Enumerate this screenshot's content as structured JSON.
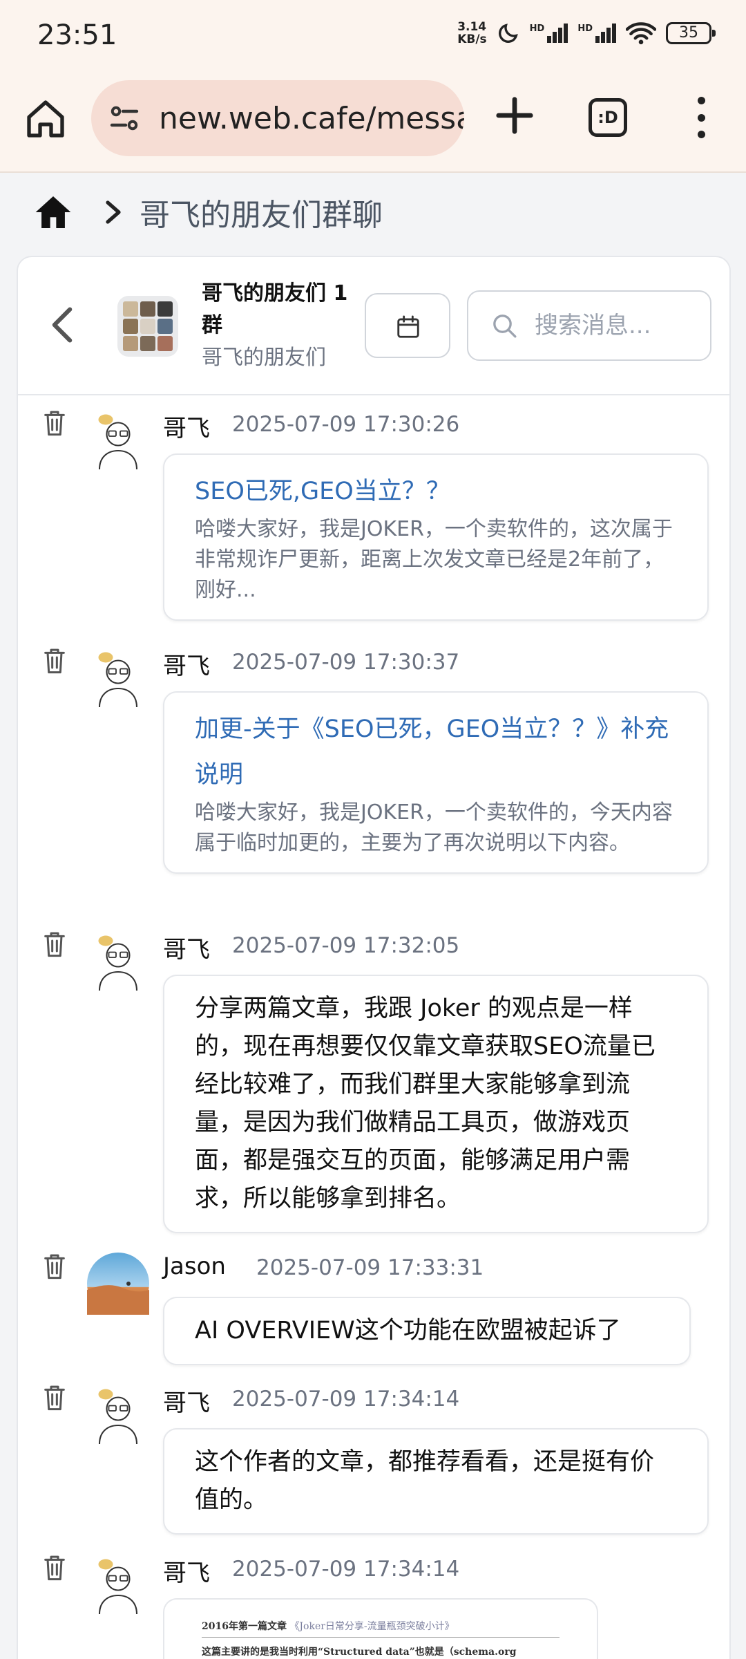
{
  "status_bar": {
    "time": "23:51",
    "net_speed_value": "3.14",
    "net_speed_unit": "KB/s",
    "sig1_label": "HD",
    "sig2_label": "HD",
    "battery": "35",
    "icons": [
      "moon-icon",
      "signal-icon",
      "signal-icon",
      "wifi-icon",
      "battery-icon"
    ]
  },
  "browser": {
    "url": "new.web.cafe/messag",
    "tabs_label": ":D",
    "icons": [
      "home-icon",
      "site-settings-icon",
      "plus-icon",
      "tabs-icon",
      "more-icon"
    ]
  },
  "breadcrumb": {
    "title": "哥飞的朋友们群聊"
  },
  "chat_header": {
    "group_name": "哥飞的朋友们 1 群",
    "group_sub": "哥飞的朋友们",
    "search_placeholder": "搜索消息..."
  },
  "messages": [
    {
      "sender": "哥飞",
      "time": "2025-07-09 17:30:26",
      "type": "link",
      "link_title": "SEO已死,GEO当立？？",
      "link_desc": "哈喽大家好，我是JOKER，一个卖软件的，这次属于非常规诈尸更新，距离上次发文章已经是2年前了，刚好..."
    },
    {
      "sender": "哥飞",
      "time": "2025-07-09 17:30:37",
      "type": "link",
      "link_title": "加更-关于《SEO已死，GEO当立？？》补充说明",
      "link_desc": "哈喽大家好，我是JOKER，一个卖软件的，今天内容属于临时加更的，主要为了再次说明以下内容。"
    },
    {
      "sender": "哥飞",
      "time": "2025-07-09 17:32:05",
      "type": "text",
      "text": "分享两篇文章，我跟 Joker 的观点是一样的，现在再想要仅仅靠文章获取SEO流量已经比较难了，而我们群里大家能够拿到流量，是因为我们做精品工具页，做游戏页面，都是强交互的页面，能够满足用户需求，所以能够拿到排名。"
    },
    {
      "sender": "Jason",
      "time": "2025-07-09 17:33:31",
      "type": "text",
      "text": "AI OVERVIEW这个功能在欧盟被起诉了"
    },
    {
      "sender": "哥飞",
      "time": "2025-07-09 17:34:14",
      "type": "text",
      "text": "这个作者的文章，都推荐看看，还是挺有价值的。"
    },
    {
      "sender": "哥飞",
      "time": "2025-07-09 17:34:14",
      "type": "image",
      "doc_line1_prefix": "2016年第一篇文章",
      "doc_line1_link": "《Joker日常分享-流量瓶颈突破小计》",
      "doc_line2": "这篇主要讲的是我当时利用“Structured data”也就是（schema.org markup）获"
    }
  ]
}
